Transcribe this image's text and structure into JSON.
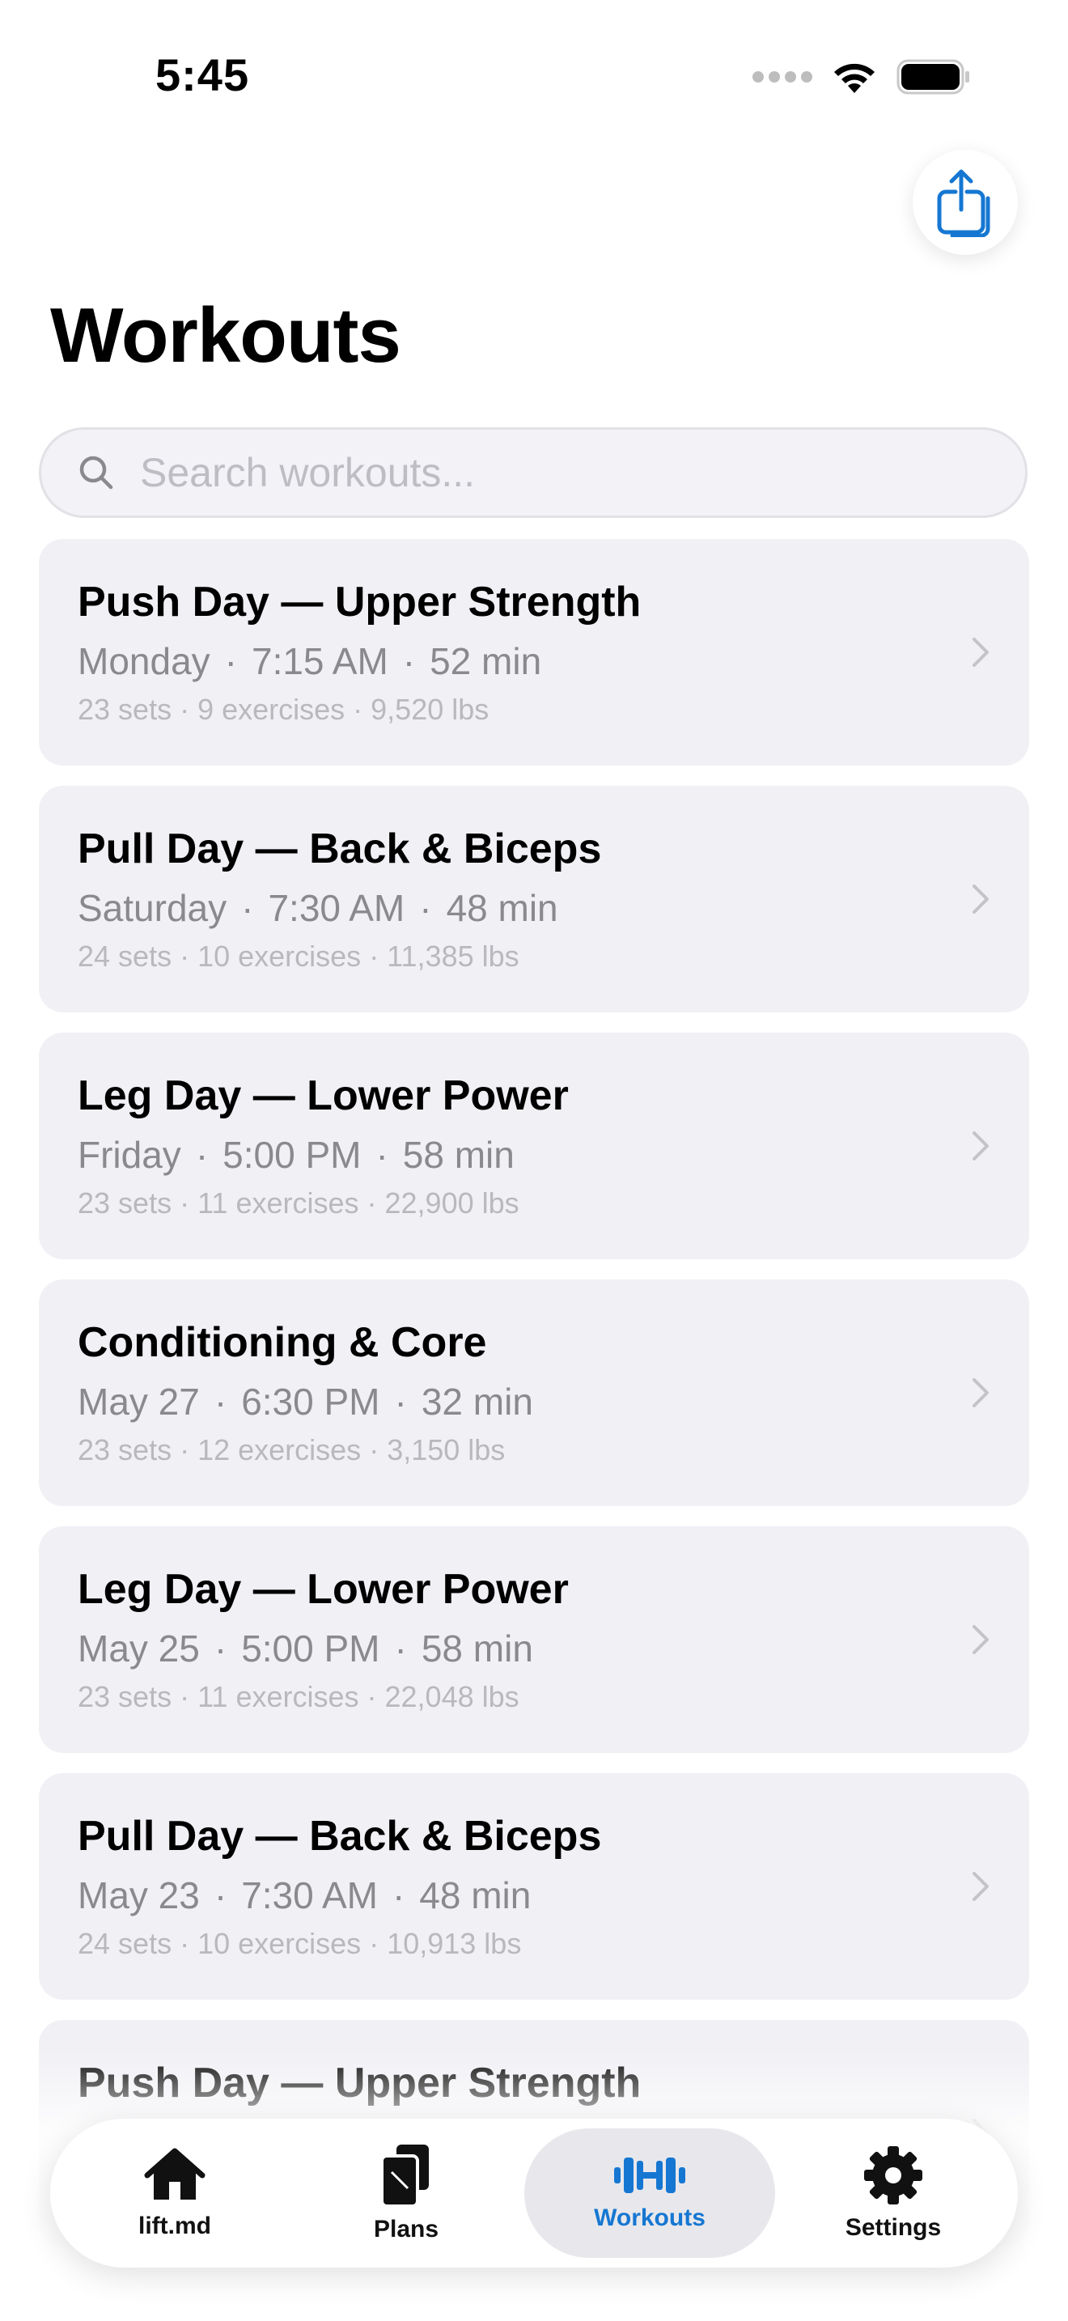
{
  "status_bar": {
    "time": "5:45"
  },
  "header": {
    "title": "Workouts",
    "share_icon": "share-icon"
  },
  "search": {
    "placeholder": "Search workouts...",
    "value": ""
  },
  "workouts": [
    {
      "title": "Push Day — Upper Strength",
      "day": "Monday",
      "time": "7:15 AM",
      "duration": "52 min",
      "sets": "23 sets",
      "exercises": "9 exercises",
      "volume": "9,520 lbs"
    },
    {
      "title": "Pull Day — Back & Biceps",
      "day": "Saturday",
      "time": "7:30 AM",
      "duration": "48 min",
      "sets": "24 sets",
      "exercises": "10 exercises",
      "volume": "11,385 lbs"
    },
    {
      "title": "Leg Day — Lower Power",
      "day": "Friday",
      "time": "5:00 PM",
      "duration": "58 min",
      "sets": "23 sets",
      "exercises": "11 exercises",
      "volume": "22,900 lbs"
    },
    {
      "title": "Conditioning & Core",
      "day": "May 27",
      "time": "6:30 PM",
      "duration": "32 min",
      "sets": "23 sets",
      "exercises": "12 exercises",
      "volume": "3,150 lbs"
    },
    {
      "title": "Leg Day — Lower Power",
      "day": "May 25",
      "time": "5:00 PM",
      "duration": "58 min",
      "sets": "23 sets",
      "exercises": "11 exercises",
      "volume": "22,048 lbs"
    },
    {
      "title": "Pull Day — Back & Biceps",
      "day": "May 23",
      "time": "7:30 AM",
      "duration": "48 min",
      "sets": "24 sets",
      "exercises": "10 exercises",
      "volume": "10,913 lbs"
    },
    {
      "title": "Push Day — Upper Strength",
      "day": "",
      "time": "",
      "duration": "",
      "sets": "",
      "exercises": "",
      "volume": ""
    }
  ],
  "separator": "·",
  "tab_bar": {
    "tabs": [
      {
        "label": "lift.md",
        "icon": "house-icon",
        "active": false
      },
      {
        "label": "Plans",
        "icon": "documents-icon",
        "active": false
      },
      {
        "label": "Workouts",
        "icon": "dumbbell-icon",
        "active": true
      },
      {
        "label": "Settings",
        "icon": "gear-icon",
        "active": false
      }
    ]
  },
  "colors": {
    "accent": "#1677d2",
    "card_background": "#f0f0f5",
    "secondary_text": "#8a8a8e",
    "tertiary_text": "#b8b8bd"
  }
}
